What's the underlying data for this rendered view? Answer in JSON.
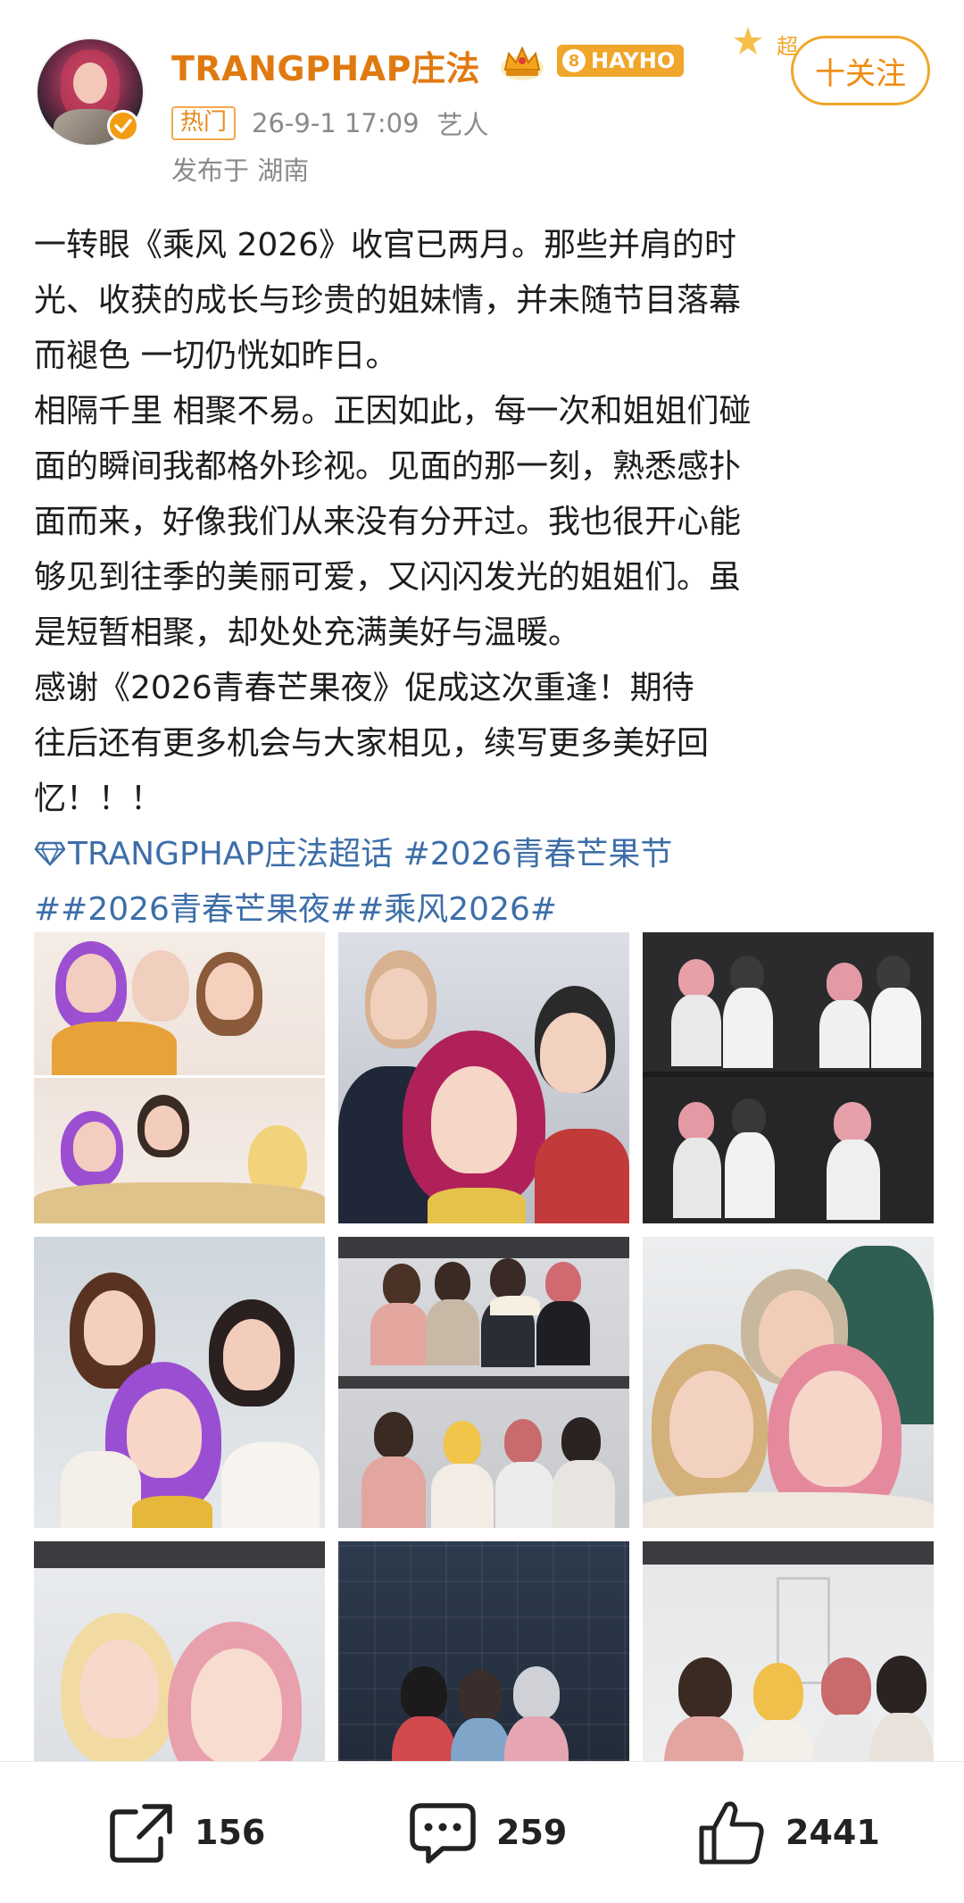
{
  "post": {
    "author": "TRANGPHAP庄法",
    "level_number": "8",
    "level_label": "HAYHO",
    "hot_tag": "热门",
    "time": "26-9-1 17:09",
    "role": "艺人",
    "location": "发布于 湖南",
    "follow_label": "十关注",
    "star_char": "超",
    "body_lines": [
      "一转眼《乘风 2026》收官已两月。那些并肩的时",
      "光、收获的成长与珍贵的姐妹情，并未随节目落幕",
      "而褪色 一切仍恍如昨日。",
      "相隔千里 相聚不易。正因如此，每一次和姐姐们碰",
      "面的瞬间我都格外珍视。见面的那一刻，熟悉感扑",
      "面而来，好像我们从来没有分开过。我也很开心能",
      "够见到往季的美丽可爱，又闪闪发光的姐姐们。虽",
      "是短暂相聚，却处处充满美好与温暖。",
      "感谢《2026青春芒果夜》促成这次重逢！期待",
      "往后还有更多机会与大家相见，续写更多美好回",
      "忆！！！"
    ],
    "topics": {
      "super_topic": "TRANGPHAP庄法超话",
      "tag1": "#2026青春芒果节",
      "tag2": "##2026青春芒果夜##乘风2026#"
    }
  },
  "actions": {
    "share_count": "156",
    "comment_count": "259",
    "like_count": "2441"
  },
  "colors": {
    "author": "#e07a10",
    "accent": "#f0a62a",
    "topic": "#3d6ea8",
    "muted": "#8a8a8a"
  },
  "icons": {
    "share": "share-icon",
    "comment": "comment-icon",
    "like": "thumbs-up-icon",
    "verified": "verified-icon",
    "crown": "crown-icon",
    "diamond": "diamond-icon"
  }
}
